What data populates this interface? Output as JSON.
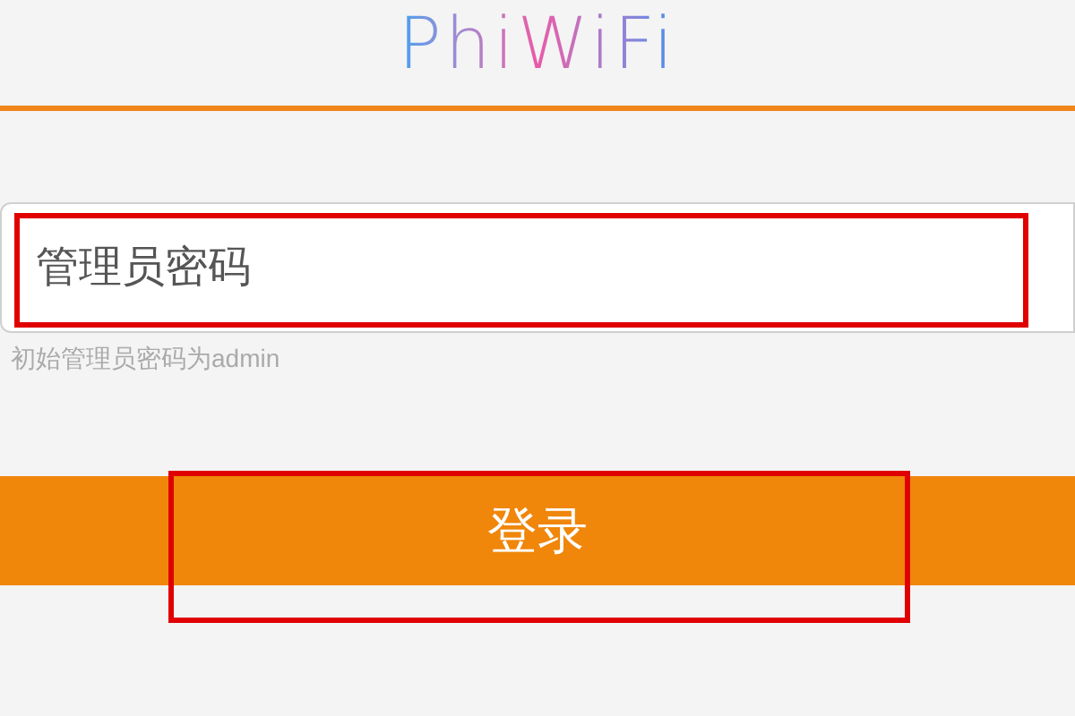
{
  "header": {
    "logo": "PhiWiFi"
  },
  "password_field": {
    "placeholder": "管理员密码",
    "highlighted": true
  },
  "hint": "初始管理员密码为admin",
  "login_button": {
    "label": "登录",
    "highlighted": true
  }
}
